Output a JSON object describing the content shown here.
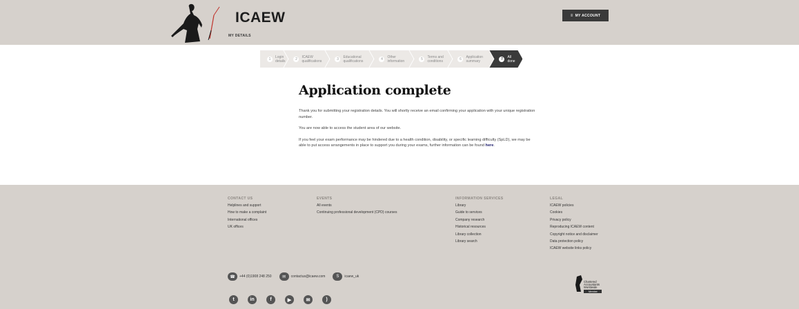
{
  "header": {
    "brand": "ICAEW",
    "section": "MY DETAILS",
    "account_button": "MY ACCOUNT",
    "account_icon": "≡"
  },
  "steps": [
    {
      "num": "1",
      "label_1": "Login",
      "label_2": "details"
    },
    {
      "num": "2",
      "label_1": "ICAEW",
      "label_2": "qualifications"
    },
    {
      "num": "3",
      "label_1": "Educational",
      "label_2": "qualifications"
    },
    {
      "num": "4",
      "label_1": "Other",
      "label_2": "information"
    },
    {
      "num": "5",
      "label_1": "Terms and",
      "label_2": "conditions"
    },
    {
      "num": "6",
      "label_1": "Application",
      "label_2": "summary"
    },
    {
      "num": "7",
      "label_1": "All",
      "label_2": "done"
    }
  ],
  "main": {
    "title": "Application complete",
    "para1": "Thank you for submitting your registration details. You will shortly receive an email confirming your application with your unique registration number.",
    "para2": "You are now able to access the student area of our website.",
    "para3": "If you feel your exam performance may be hindered due to a health condition, disability, or specific learning difficulty (SpLD), we may be able to put access arrangements in place to support you during your exams, further information can be found ",
    "para3_link": "here",
    "para3_end": "."
  },
  "footer": {
    "contact": {
      "heading": "CONTACT US",
      "links": [
        "Helplines and support",
        "How to make a complaint",
        "International offices",
        "UK offices"
      ]
    },
    "events": {
      "heading": "EVENTS",
      "links": [
        "All events",
        "Continuing professional development (CPD) courses"
      ]
    },
    "info": {
      "heading": "INFORMATION SERVICES",
      "links": [
        "Library",
        "Guide to services",
        "Company research",
        "Historical resources",
        "Library collection",
        "Library search"
      ]
    },
    "legal": {
      "heading": "LEGAL",
      "links": [
        "ICAEW policies",
        "Cookies",
        "Privacy policy",
        "Reproducing ICAEW content",
        "Copyright notice and disclaimer",
        "Data protection policy",
        "ICAEW website links policy"
      ]
    },
    "phone": "+44 (0)1908 248 250",
    "email": "contactus@icaew.com",
    "skype": "icaew_uk",
    "caw": {
      "line1": "Chartered",
      "line2": "Accountants",
      "line3": "Worldwide",
      "line4": "Member"
    }
  }
}
